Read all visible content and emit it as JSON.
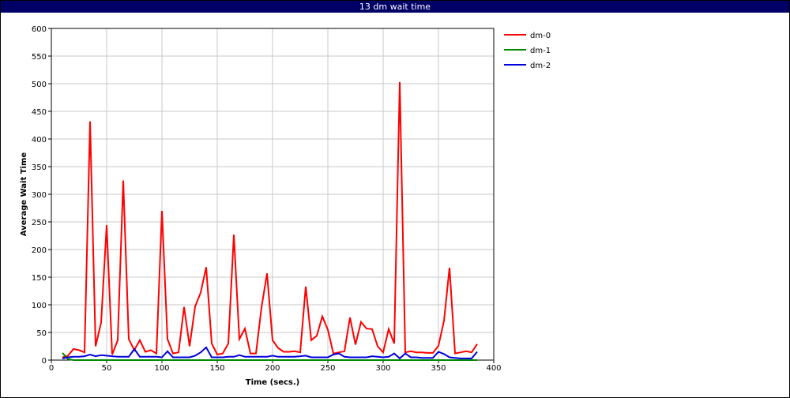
{
  "window": {
    "title": "13 dm wait time"
  },
  "chart_data": {
    "type": "line",
    "title": "13 dm wait time",
    "xlabel": "Time (secs.)",
    "ylabel": "Average Wait Time",
    "xlim": [
      0,
      400
    ],
    "ylim": [
      0,
      600
    ],
    "xticks": [
      0,
      50,
      100,
      150,
      200,
      250,
      300,
      350,
      400
    ],
    "yticks": [
      0,
      50,
      100,
      150,
      200,
      250,
      300,
      350,
      400,
      450,
      500,
      550,
      600
    ],
    "grid": true,
    "legend_position": "top-right",
    "series": [
      {
        "name": "dm-0",
        "color": "#ff0000",
        "x": [
          10,
          15,
          20,
          25,
          30,
          35,
          40,
          45,
          50,
          55,
          60,
          65,
          70,
          75,
          80,
          85,
          90,
          95,
          100,
          105,
          110,
          115,
          120,
          125,
          130,
          135,
          140,
          145,
          150,
          155,
          160,
          165,
          170,
          175,
          180,
          185,
          190,
          195,
          200,
          205,
          210,
          215,
          220,
          225,
          230,
          235,
          240,
          245,
          250,
          255,
          260,
          265,
          270,
          275,
          280,
          285,
          290,
          295,
          300,
          305,
          310,
          315,
          320,
          325,
          330,
          335,
          340,
          345,
          350,
          355,
          360,
          365,
          370,
          375,
          380,
          385
        ],
        "y": [
          5,
          8,
          20,
          18,
          14,
          432,
          25,
          68,
          244,
          10,
          36,
          325,
          38,
          18,
          36,
          15,
          18,
          12,
          270,
          38,
          12,
          14,
          96,
          25,
          97,
          122,
          168,
          30,
          10,
          12,
          30,
          227,
          38,
          57,
          12,
          12,
          95,
          157,
          36,
          22,
          15,
          15,
          16,
          14,
          133,
          36,
          44,
          79,
          55,
          12,
          14,
          16,
          77,
          28,
          69,
          57,
          56,
          25,
          14,
          56,
          30,
          503,
          14,
          16,
          14,
          14,
          13,
          13,
          26,
          71,
          167,
          12,
          14,
          16,
          14,
          29
        ]
      },
      {
        "name": "dm-1",
        "color": "#008800",
        "x": [
          10,
          15,
          20,
          25,
          30,
          35,
          40,
          45,
          50,
          55,
          60,
          65,
          70,
          75,
          80,
          85,
          90,
          95,
          100,
          105,
          110,
          115,
          120,
          125,
          130,
          135,
          140,
          145,
          150,
          155,
          160,
          165,
          170,
          175,
          180,
          185,
          190,
          195,
          200,
          205,
          210,
          215,
          220,
          225,
          230,
          235,
          240,
          245,
          250,
          255,
          260,
          265,
          270,
          275,
          280,
          285,
          290,
          295,
          300,
          305,
          310,
          315,
          320,
          325,
          330,
          335,
          340,
          345,
          350,
          355,
          360,
          365,
          370,
          375,
          380,
          385
        ],
        "y": [
          13,
          2,
          0,
          0,
          0,
          0,
          0,
          0,
          0,
          0,
          0,
          0,
          0,
          0,
          0,
          0,
          0,
          0,
          0,
          0,
          0,
          0,
          0,
          0,
          0,
          0,
          0,
          0,
          0,
          0,
          0,
          0,
          0,
          0,
          0,
          0,
          0,
          0,
          0,
          0,
          0,
          0,
          0,
          0,
          0,
          0,
          0,
          0,
          0,
          0,
          0,
          0,
          0,
          0,
          0,
          0,
          0,
          0,
          0,
          0,
          0,
          0,
          0,
          0,
          0,
          0,
          0,
          0,
          0,
          0,
          0,
          0,
          0,
          0,
          0,
          0
        ]
      },
      {
        "name": "dm-2",
        "color": "#0000dd",
        "x": [
          10,
          15,
          20,
          25,
          30,
          35,
          40,
          45,
          50,
          55,
          60,
          65,
          70,
          75,
          80,
          85,
          90,
          95,
          100,
          105,
          110,
          115,
          120,
          125,
          130,
          135,
          140,
          145,
          150,
          155,
          160,
          165,
          170,
          175,
          180,
          185,
          190,
          195,
          200,
          205,
          210,
          215,
          220,
          225,
          230,
          235,
          240,
          245,
          250,
          255,
          260,
          265,
          270,
          275,
          280,
          285,
          290,
          295,
          300,
          305,
          310,
          315,
          320,
          325,
          330,
          335,
          340,
          345,
          350,
          355,
          360,
          365,
          370,
          375,
          380,
          385
        ],
        "y": [
          3,
          5,
          6,
          6,
          7,
          10,
          7,
          9,
          8,
          7,
          6,
          6,
          6,
          20,
          6,
          6,
          6,
          6,
          5,
          16,
          5,
          5,
          5,
          5,
          8,
          14,
          23,
          5,
          5,
          5,
          6,
          6,
          9,
          6,
          6,
          6,
          6,
          6,
          8,
          6,
          6,
          6,
          6,
          7,
          8,
          5,
          5,
          5,
          5,
          10,
          12,
          6,
          5,
          5,
          5,
          5,
          7,
          6,
          5,
          6,
          12,
          3,
          12,
          5,
          5,
          4,
          4,
          4,
          15,
          11,
          5,
          4,
          3,
          3,
          3,
          15
        ]
      }
    ]
  }
}
